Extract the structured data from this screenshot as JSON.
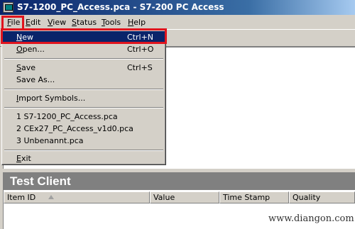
{
  "window": {
    "title": "S7-1200_PC_Access.pca - S7-200 PC Access"
  },
  "menubar": {
    "items": [
      "File",
      "Edit",
      "View",
      "Status",
      "Tools",
      "Help"
    ]
  },
  "file_menu": {
    "new": {
      "label": "New",
      "shortcut": "Ctrl+N"
    },
    "open": {
      "label": "Open...",
      "shortcut": "Ctrl+O"
    },
    "save": {
      "label": "Save",
      "shortcut": "Ctrl+S"
    },
    "save_as": {
      "label": "Save As..."
    },
    "import_symbols": {
      "label": "Import Symbols..."
    },
    "recent": [
      "1 S7-1200_PC_Access.pca",
      "2 CEx27_PC_Access_v1d0.pca",
      "3 Unbenannt.pca"
    ],
    "exit": {
      "label": "Exit"
    }
  },
  "test_client": {
    "title": "Test Client",
    "columns": [
      "Item ID",
      "Value",
      "Time Stamp",
      "Quality"
    ]
  },
  "watermark": "www.diangon.com"
}
